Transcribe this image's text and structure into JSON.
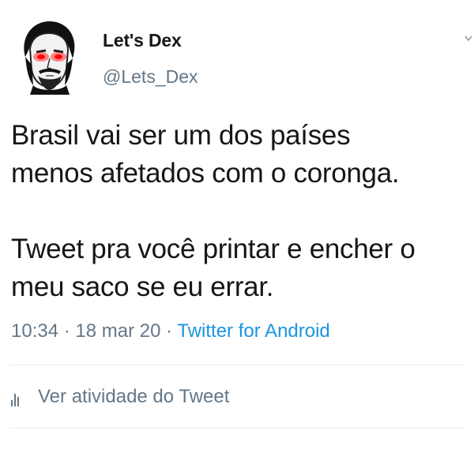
{
  "author": {
    "display_name": "Let's Dex",
    "handle": "@Lets_Dex",
    "avatar_icon": "keanu-meme-avatar-red-eyes"
  },
  "tweet": {
    "text": "Brasil vai ser um dos países\nmenos afetados com o coronga.\n\nTweet pra você printar e encher o\nmeu saco se eu errar.",
    "time": "10:34",
    "separator": " · ",
    "date": "18 mar 20",
    "source": "Twitter for Android"
  },
  "actions": {
    "activity_label": "Ver atividade do Tweet",
    "activity_icon": "analytics-bars-icon"
  },
  "colors": {
    "text": "#14171a",
    "secondary": "#657786",
    "link": "#1b95e0",
    "divider": "#e6ecf0"
  }
}
